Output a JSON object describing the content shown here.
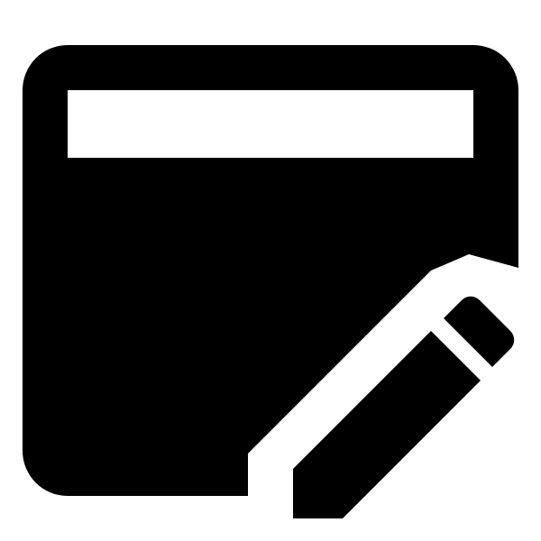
{
  "icon": {
    "name": "edit-note-icon",
    "foreground": "#000000",
    "background": "#ffffff"
  }
}
